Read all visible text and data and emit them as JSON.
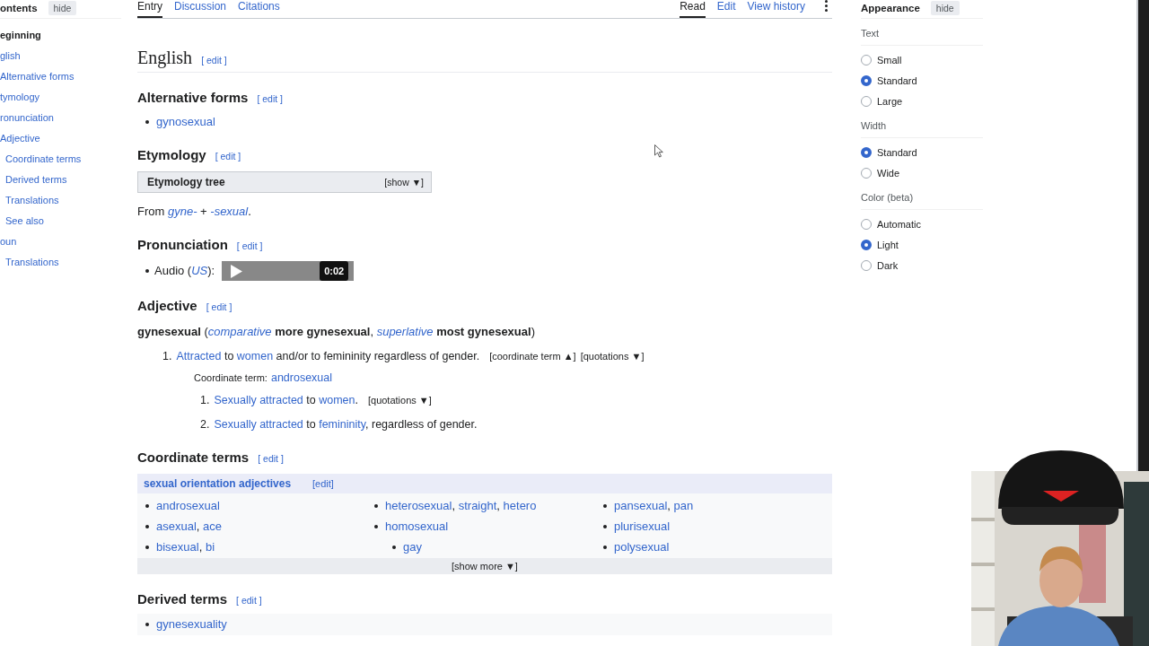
{
  "tabs_left": [
    {
      "label": "Entry",
      "selected": true
    },
    {
      "label": "Discussion",
      "selected": false
    },
    {
      "label": "Citations",
      "selected": false
    }
  ],
  "tabs_right": [
    {
      "label": "Read",
      "selected": true
    },
    {
      "label": "Edit",
      "selected": false
    },
    {
      "label": "View history",
      "selected": false
    }
  ],
  "toc": {
    "title": "ontents",
    "hide": "hide",
    "items": [
      {
        "label": "eginning",
        "kind": "top"
      },
      {
        "label": "glish",
        "kind": "link"
      },
      {
        "label": "Alternative forms",
        "kind": "link"
      },
      {
        "label": "tymology",
        "kind": "link"
      },
      {
        "label": "ronunciation",
        "kind": "link"
      },
      {
        "label": "Adjective",
        "kind": "link",
        "children": [
          {
            "label": "Coordinate terms",
            "kind": "link"
          },
          {
            "label": "Derived terms",
            "kind": "link"
          },
          {
            "label": "Translations",
            "kind": "link"
          },
          {
            "label": "See also",
            "kind": "link"
          }
        ]
      },
      {
        "label": "oun",
        "kind": "link",
        "children": [
          {
            "label": "Translations",
            "kind": "link"
          }
        ]
      }
    ]
  },
  "sections": [
    {
      "kind": "language",
      "title": "English",
      "edit": "[ edit ]"
    },
    {
      "kind": "heading",
      "title": "Alternative forms",
      "edit": "[ edit ]",
      "blocks": [
        {
          "kind": "bullets",
          "items": [
            [
              {
                "kind": "link",
                "text": "gynosexual"
              }
            ]
          ]
        }
      ]
    },
    {
      "kind": "heading",
      "title": "Etymology",
      "edit": "[ edit ]",
      "blocks": [
        {
          "kind": "collapsible",
          "title": "Etymology tree",
          "toggle": "[show ▼]"
        },
        {
          "kind": "paragraph",
          "segments": [
            {
              "kind": "text",
              "text": "From "
            },
            {
              "kind": "link-italic",
              "text": "gyne-"
            },
            {
              "kind": "text",
              "text": " + "
            },
            {
              "kind": "link-italic",
              "text": "-sexual"
            },
            {
              "kind": "text",
              "text": "."
            }
          ]
        }
      ]
    },
    {
      "kind": "heading",
      "title": "Pronunciation",
      "edit": "[ edit ]",
      "blocks": [
        {
          "kind": "audio",
          "segments": [
            {
              "kind": "text",
              "text": "Audio ("
            },
            {
              "kind": "link-italic",
              "text": "US"
            },
            {
              "kind": "text",
              "text": "):"
            }
          ],
          "time": "0:02"
        }
      ]
    },
    {
      "kind": "heading",
      "title": "Adjective",
      "edit": "[ edit ]",
      "blocks": [
        {
          "kind": "paragraph",
          "segments": [
            {
              "kind": "bold",
              "text": "gynesexual"
            },
            {
              "kind": "text",
              "text": " ("
            },
            {
              "kind": "link-italic",
              "text": "comparative"
            },
            {
              "kind": "bold",
              "text": " more gynesexual"
            },
            {
              "kind": "text",
              "text": ", "
            },
            {
              "kind": "link-italic",
              "text": "superlative"
            },
            {
              "kind": "bold",
              "text": " most gynesexual"
            },
            {
              "kind": "text",
              "text": ")"
            }
          ]
        },
        {
          "kind": "definitions",
          "items": [
            {
              "number": "1.",
              "segments": [
                {
                  "kind": "link",
                  "text": "Attracted"
                },
                {
                  "kind": "text",
                  "text": " to "
                },
                {
                  "kind": "link",
                  "text": "women"
                },
                {
                  "kind": "text",
                  "text": " and/or to femininity regardless of gender."
                }
              ],
              "toggles": [
                "[coordinate term ▲]",
                "[quotations ▼]"
              ],
              "note": {
                "label": "Coordinate term:",
                "link": "androsexual"
              },
              "subitems": [
                {
                  "number": "1.",
                  "segments": [
                    {
                      "kind": "link",
                      "text": "Sexually attracted"
                    },
                    {
                      "kind": "text",
                      "text": " to "
                    },
                    {
                      "kind": "link",
                      "text": "women"
                    },
                    {
                      "kind": "text",
                      "text": "."
                    }
                  ],
                  "toggles": [
                    "[quotations ▼]"
                  ]
                },
                {
                  "number": "2.",
                  "segments": [
                    {
                      "kind": "link",
                      "text": "Sexually attracted"
                    },
                    {
                      "kind": "text",
                      "text": " to "
                    },
                    {
                      "kind": "link",
                      "text": "femininity"
                    },
                    {
                      "kind": "text",
                      "text": ", regardless of gender."
                    }
                  ]
                }
              ]
            }
          ]
        }
      ]
    },
    {
      "kind": "heading",
      "title": "Coordinate terms",
      "edit": "[ edit ]",
      "blocks": [
        {
          "kind": "navbox",
          "title": "sexual orientation adjectives",
          "edit": "[edit]",
          "more": "[show more ▼]",
          "columns": [
            [
              {
                "segments": [
                  {
                    "kind": "link",
                    "text": "androsexual"
                  }
                ]
              },
              {
                "segments": [
                  {
                    "kind": "link",
                    "text": "asexual"
                  },
                  {
                    "kind": "text",
                    "text": ", "
                  },
                  {
                    "kind": "link",
                    "text": "ace"
                  }
                ]
              },
              {
                "segments": [
                  {
                    "kind": "link",
                    "text": "bisexual"
                  },
                  {
                    "kind": "text",
                    "text": ", "
                  },
                  {
                    "kind": "link",
                    "text": "bi"
                  }
                ]
              }
            ],
            [
              {
                "segments": [
                  {
                    "kind": "link",
                    "text": "heterosexual"
                  },
                  {
                    "kind": "text",
                    "text": ", "
                  },
                  {
                    "kind": "link",
                    "text": "straight"
                  },
                  {
                    "kind": "text",
                    "text": ", "
                  },
                  {
                    "kind": "link",
                    "text": "hetero"
                  }
                ]
              },
              {
                "segments": [
                  {
                    "kind": "link",
                    "text": "homosexual"
                  }
                ],
                "children": [
                  {
                    "segments": [
                      {
                        "kind": "link",
                        "text": "gay"
                      }
                    ]
                  }
                ]
              }
            ],
            [
              {
                "segments": [
                  {
                    "kind": "link",
                    "text": "pansexual"
                  },
                  {
                    "kind": "text",
                    "text": ", "
                  },
                  {
                    "kind": "link",
                    "text": "pan"
                  }
                ]
              },
              {
                "segments": [
                  {
                    "kind": "link",
                    "text": "plurisexual"
                  }
                ]
              },
              {
                "segments": [
                  {
                    "kind": "link",
                    "text": "polysexual"
                  }
                ]
              }
            ]
          ]
        }
      ]
    },
    {
      "kind": "heading",
      "title": "Derived terms",
      "edit": "[ edit ]",
      "blocks": [
        {
          "kind": "termlist",
          "items": [
            [
              {
                "kind": "link",
                "text": "gynesexuality"
              }
            ]
          ]
        }
      ]
    }
  ],
  "appearance": {
    "title": "Appearance",
    "hide": "hide",
    "groups": [
      {
        "label": "Text",
        "options": [
          {
            "label": "Small",
            "selected": false
          },
          {
            "label": "Standard",
            "selected": true
          },
          {
            "label": "Large",
            "selected": false
          }
        ]
      },
      {
        "label": "Width",
        "options": [
          {
            "label": "Standard",
            "selected": true
          },
          {
            "label": "Wide",
            "selected": false
          }
        ]
      },
      {
        "label": "Color (beta)",
        "options": [
          {
            "label": "Automatic",
            "selected": false
          },
          {
            "label": "Light",
            "selected": true
          },
          {
            "label": "Dark",
            "selected": false
          }
        ]
      }
    ]
  }
}
